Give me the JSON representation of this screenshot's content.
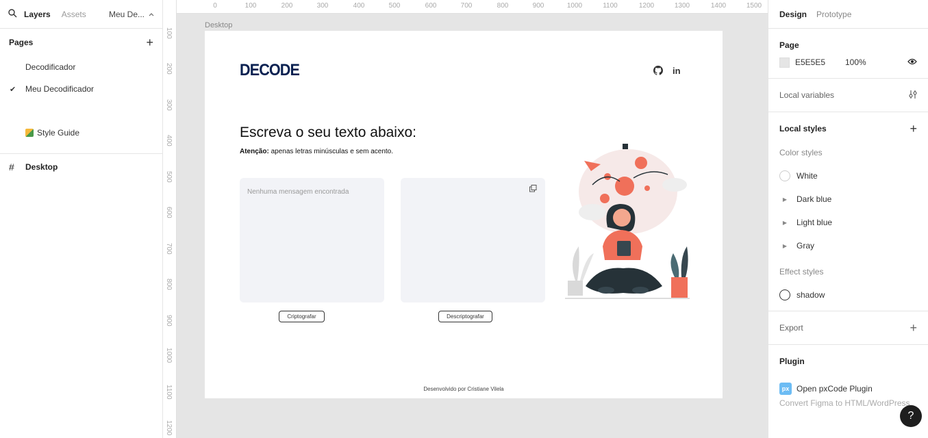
{
  "left_panel": {
    "tabs": {
      "layers": "Layers",
      "assets": "Assets"
    },
    "file_name": "Meu De...",
    "pages_title": "Pages",
    "pages": [
      {
        "label": "Decodificador",
        "selected": false
      },
      {
        "label": "Meu Decodificador",
        "selected": true
      },
      {
        "label": "Style Guide",
        "selected": false
      }
    ],
    "layers": [
      {
        "label": "Desktop"
      }
    ]
  },
  "canvas": {
    "ruler_top": [
      "0",
      "100",
      "200",
      "300",
      "400",
      "500",
      "600",
      "700",
      "800",
      "900",
      "1000",
      "1100",
      "1200",
      "1300",
      "1400",
      "1500"
    ],
    "ruler_left": [
      "100",
      "200",
      "300",
      "400",
      "500",
      "600",
      "700",
      "800",
      "900",
      "1000",
      "1100",
      "1200"
    ],
    "frame_label": "Desktop",
    "frame": {
      "logo": "DECODE",
      "social_github": "github-icon",
      "social_linkedin": "in",
      "headline": "Escreva o seu texto abaixo:",
      "notice_bold": "Atenção:",
      "notice_text": " apenas letras minúsculas e sem acento.",
      "input_placeholder": "Nenhuma mensagem encontrada",
      "encrypt_button": "Criptografar",
      "decrypt_button": "Descriptografar",
      "footer": "Desenvolvido por Cristiane Vilela"
    }
  },
  "right_panel": {
    "tabs": {
      "design": "Design",
      "prototype": "Prototype"
    },
    "page_title": "Page",
    "page_color": "E5E5E5",
    "page_opacity": "100%",
    "local_variables": "Local variables",
    "local_styles": "Local styles",
    "color_styles_title": "Color styles",
    "color_styles": [
      "White",
      "Dark blue",
      "Light blue",
      "Gray"
    ],
    "effect_styles_title": "Effect styles",
    "effect_styles": [
      "shadow"
    ],
    "export_title": "Export",
    "plugin_title": "Plugin",
    "plugin_badge": "px",
    "plugin_name": "Open pxCode Plugin",
    "plugin_desc": "Convert Figma to HTML/WordPress",
    "help": "?"
  },
  "colors": {
    "logo": "#0a2151",
    "canvas_bg": "#e5e5e5",
    "box_bg": "#f2f3f7",
    "accent_illustration": "#f0705a"
  }
}
